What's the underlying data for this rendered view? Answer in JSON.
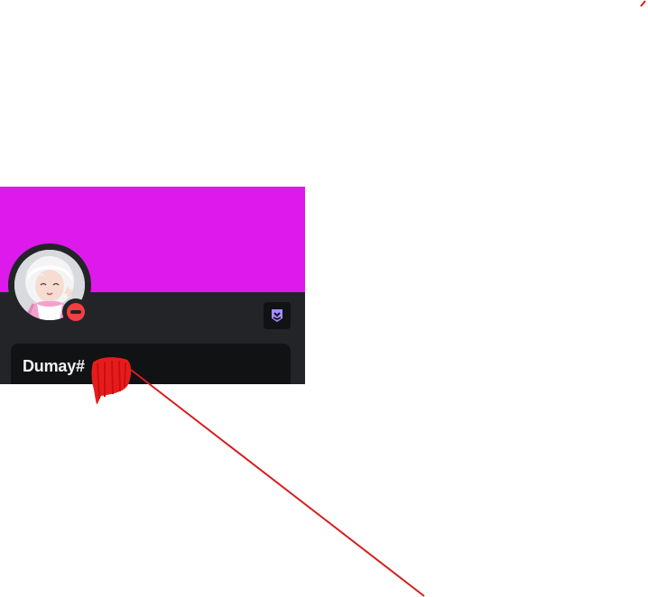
{
  "profile": {
    "username": "Dumay",
    "discriminator_prefix": "#",
    "status": "do-not-disturb",
    "avatar_icon": "anime-avatar-icon",
    "badge_icon": "nitro-badge-icon"
  },
  "colors": {
    "banner": "#dd19ec",
    "card_background": "#232428",
    "panel_background": "#111214",
    "status_dnd": "#f23f43",
    "badge_accent": "#a58cff",
    "annotation_red": "#e61c1c",
    "username_text": "#f2f3f5"
  }
}
